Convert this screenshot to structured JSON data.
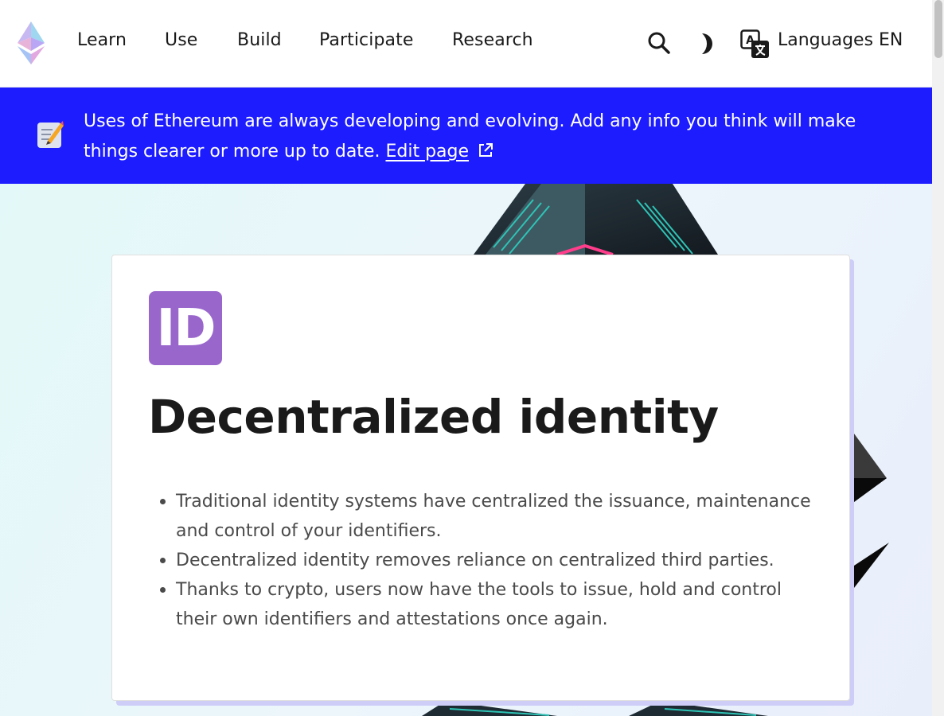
{
  "nav": {
    "items": [
      {
        "label": "Learn"
      },
      {
        "label": "Use"
      },
      {
        "label": "Build"
      },
      {
        "label": "Participate"
      },
      {
        "label": "Research"
      }
    ],
    "languages_label": "Languages EN",
    "icons": [
      "ethereum-logo-icon",
      "search-icon",
      "moon-icon",
      "translate-icon"
    ]
  },
  "banner": {
    "text": "Uses of Ethereum are always developing and evolving. Add any info you think will make things clearer or more up to date.",
    "link_label": "Edit page",
    "background": "#1c1cff",
    "icons": [
      "memo-icon",
      "external-link-icon"
    ]
  },
  "hero": {
    "badge_text": "ID",
    "badge_color": "#9966cc",
    "title": "Decentralized identity",
    "bullets": [
      "Traditional identity systems have centralized the issuance, maintenance and control of your identifiers.",
      "Decentralized identity removes reliance on centralized third parties.",
      "Thanks to crypto, users now have the tools to issue, hold and control their own identifiers and attestations once again."
    ]
  }
}
